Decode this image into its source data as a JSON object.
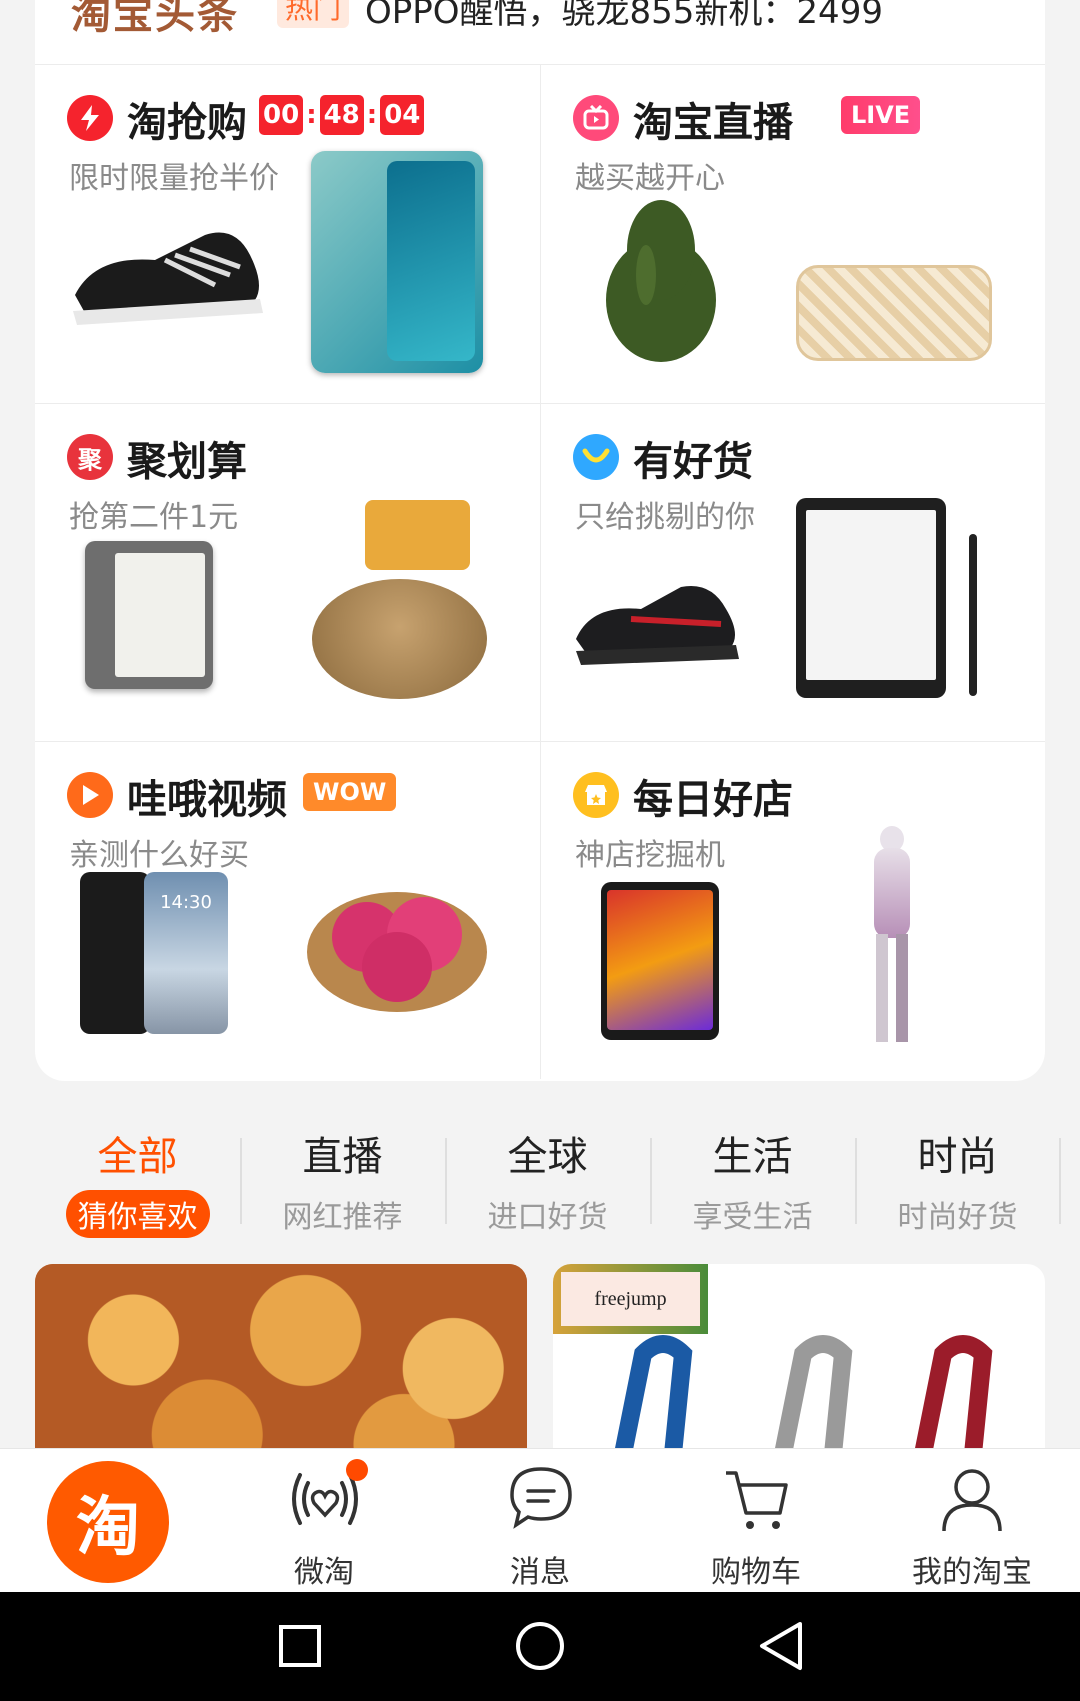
{
  "headline": {
    "brand": "淘宝头条",
    "tag": "热门",
    "text": "OPPO醒悟，骁龙855新机：2499"
  },
  "cards": [
    {
      "title": "淘抢购",
      "subtitle": "限时限量抢半价",
      "timer": [
        "00",
        "48",
        "04"
      ],
      "icon": "lightning-icon"
    },
    {
      "title": "淘宝直播",
      "subtitle": "越买越开心",
      "badge": "LIVE",
      "icon": "tv-icon"
    },
    {
      "title": "聚划算",
      "subtitle": "抢第二件1元",
      "icon_text": "聚",
      "icon": "juhuasuan-icon"
    },
    {
      "title": "有好货",
      "subtitle": "只给挑剔的你",
      "icon": "smile-icon"
    },
    {
      "title": "哇哦视频",
      "subtitle": "亲测什么好买",
      "badge": "WOW",
      "icon": "play-icon"
    },
    {
      "title": "每日好店",
      "subtitle": "神店挖掘机",
      "icon": "shop-icon"
    }
  ],
  "product_labels": {
    "phone_time": "14:30"
  },
  "tabs": [
    {
      "title": "全部",
      "subtitle": "猜你喜欢",
      "active": true
    },
    {
      "title": "直播",
      "subtitle": "网红推荐"
    },
    {
      "title": "全球",
      "subtitle": "进口好货"
    },
    {
      "title": "生活",
      "subtitle": "享受生活"
    },
    {
      "title": "时尚",
      "subtitle": "时尚好货"
    }
  ],
  "feed": {
    "right_logo": "freejump"
  },
  "tabbar": [
    {
      "label": "淘",
      "icon": "taobao-home-icon"
    },
    {
      "label": "微淘",
      "icon": "weitao-icon"
    },
    {
      "label": "消息",
      "icon": "message-icon"
    },
    {
      "label": "购物车",
      "icon": "cart-icon"
    },
    {
      "label": "我的淘宝",
      "icon": "user-icon"
    }
  ],
  "colors": {
    "accent": "#ff5000",
    "timer_red": "#f5232d",
    "live_pink": "#ff3c6b",
    "wow_orange": "#ff8a2a"
  }
}
